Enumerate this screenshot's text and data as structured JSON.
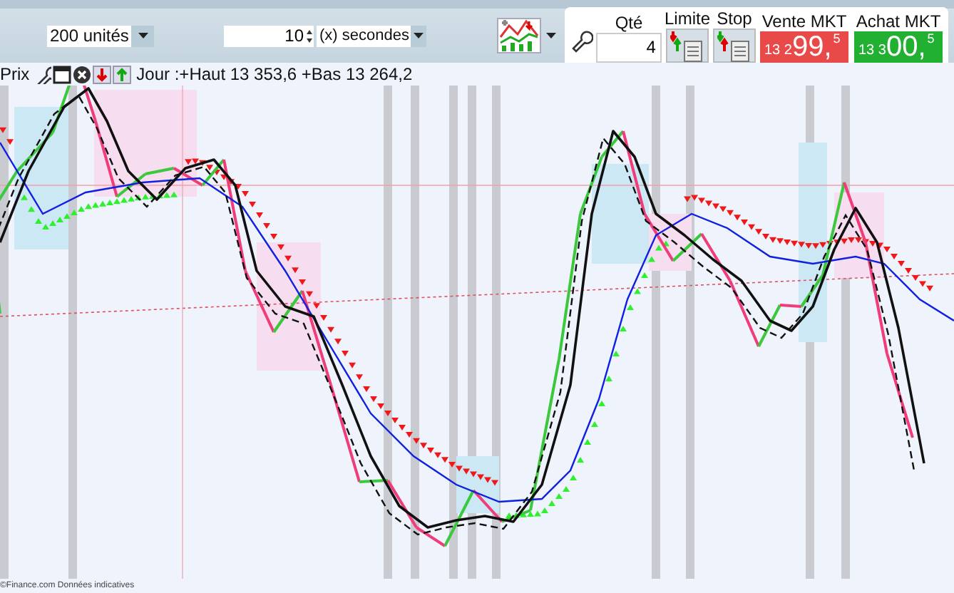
{
  "toolbar": {
    "quantity_select": {
      "value": "200 unités"
    },
    "interval_field": {
      "value": "10"
    },
    "interval_unit_select": {
      "value": "(x) secondes"
    }
  },
  "order_panel": {
    "qty_label": "Qté",
    "qty_value": "4",
    "limit_button": "Limite",
    "stop_button": "Stop",
    "quotes": [
      {
        "kind": "sell",
        "label": "Vente MKT",
        "price_prefix": "13 2",
        "price_main": "99,",
        "price_decimal": "5"
      },
      {
        "kind": "buy",
        "label": "Achat MKT",
        "price_prefix": "13 3",
        "price_main": "00,",
        "price_decimal": "5"
      }
    ]
  },
  "chart": {
    "legend_label": "Prix",
    "legend_text": "Jour :+Haut 13 353,6 +Bas 13 264,2",
    "footer": "©Finance.com Données indicatives"
  }
}
